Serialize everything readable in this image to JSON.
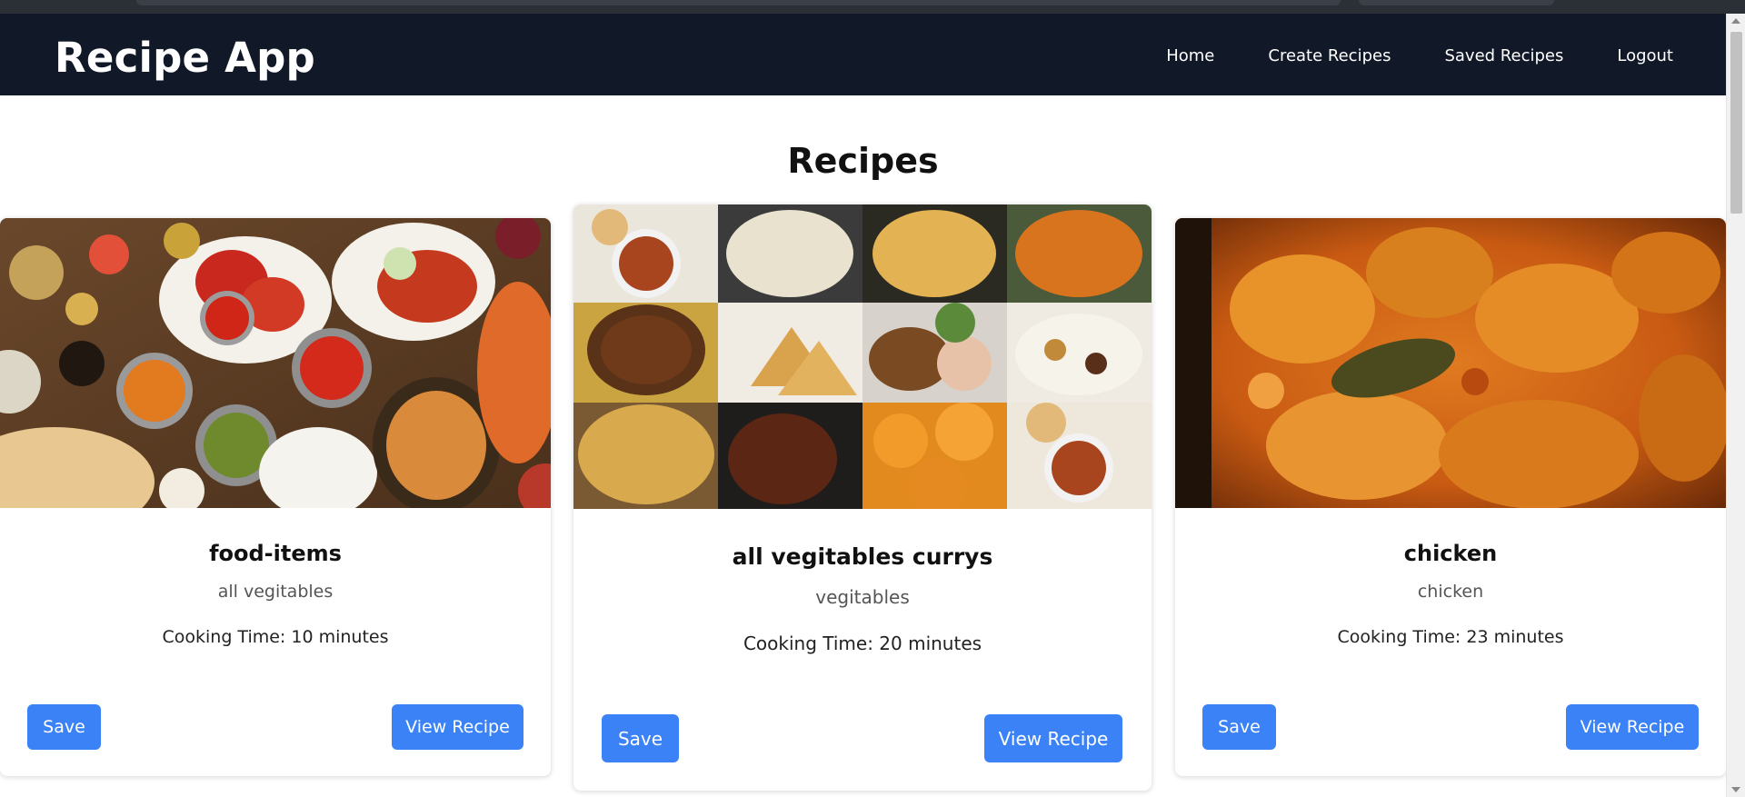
{
  "app": {
    "title": "Recipe App"
  },
  "nav": {
    "items": [
      {
        "label": "Home"
      },
      {
        "label": "Create Recipes"
      },
      {
        "label": "Saved Recipes"
      },
      {
        "label": "Logout"
      }
    ]
  },
  "main": {
    "heading": "Recipes"
  },
  "recipes": [
    {
      "name": "food-items",
      "description": "all vegitables",
      "cooking_time": "Cooking Time: 10 minutes",
      "image_icon": "indian-food-spread-photo",
      "save_label": "Save",
      "view_label": "View Recipe"
    },
    {
      "name": "all vegitables currys",
      "description": "vegitables",
      "cooking_time": "Cooking Time: 20 minutes",
      "image_icon": "food-collage-photo",
      "save_label": "Save",
      "view_label": "View Recipe"
    },
    {
      "name": "chicken",
      "description": "chicken",
      "cooking_time": "Cooking Time: 23 minutes",
      "image_icon": "chicken-curry-photo",
      "save_label": "Save",
      "view_label": "View Recipe"
    }
  ],
  "colors": {
    "navbar_bg": "#111827",
    "button_bg": "#3b82f6",
    "text_primary": "#111111",
    "text_muted": "#555555"
  }
}
